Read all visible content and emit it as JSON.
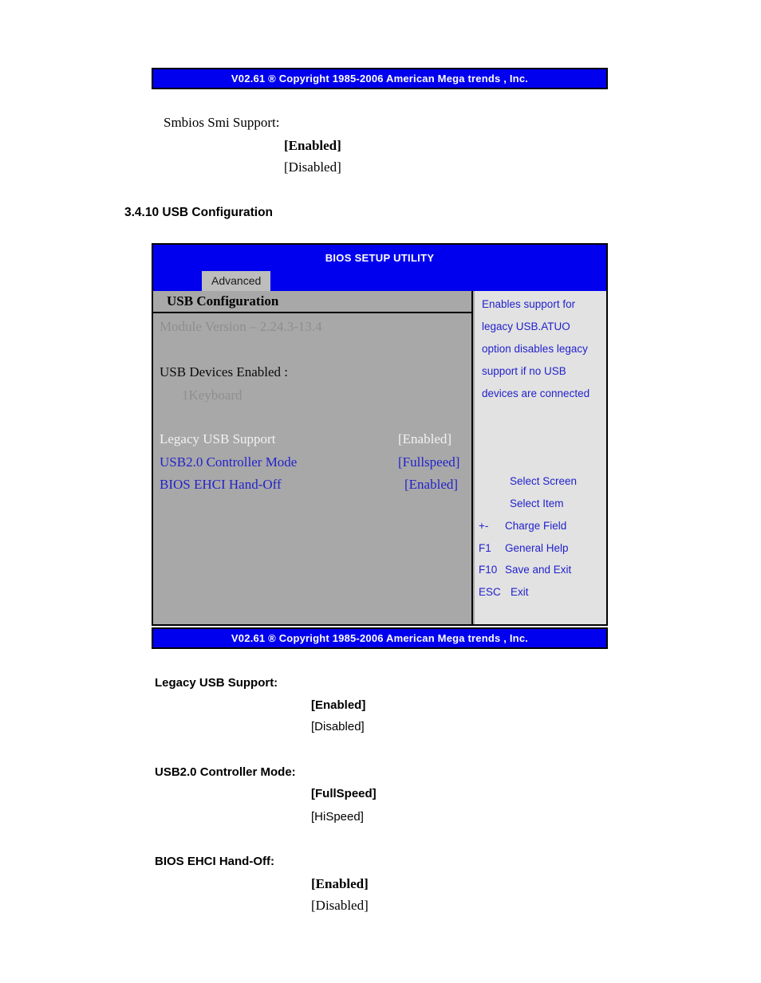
{
  "document": {
    "top_ami_bar": "V02.61 ® Copyright 1985-2006 American Mega trends , Inc.",
    "bottom_ami_bar": "V02.61 ® Copyright 1985-2006 American Mega trends , Inc.",
    "intro": {
      "label": "Smbios Smi Support:",
      "option_selected": "[Enabled]",
      "option_other": "[Disabled]"
    },
    "section_heading": "3.4.10 USB Configuration",
    "option_blocks": [
      {
        "heading": "Legacy USB Support:",
        "selected": "[Enabled]",
        "other": "[Disabled]"
      },
      {
        "heading": "USB2.0 Controller Mode:",
        "selected": "[FullSpeed]",
        "other": "[HiSpeed]"
      },
      {
        "heading": "BIOS EHCI Hand-Off:",
        "selected": "[Enabled]",
        "other": "[Disabled]"
      }
    ]
  },
  "bios": {
    "title": "BIOS SETUP UTILITY",
    "active_tab": "Advanced",
    "pane_title": "USB Configuration",
    "module_version": "Module Version – 2.24.3-13.4",
    "devices_label": "USB Devices Enabled :",
    "devices_value": "1Keyboard",
    "settings": [
      {
        "name": "Legacy USB Support",
        "value": "[Enabled]"
      },
      {
        "name": "USB2.0 Controller Mode",
        "value": "[Fullspeed]"
      },
      {
        "name": "BIOS EHCI Hand-Off",
        "value": "[Enabled]"
      }
    ],
    "help_lines": [
      "Enables support for",
      "legacy USB.ATUO",
      "option disables legacy",
      "support if no USB",
      "devices are connected"
    ],
    "legend": [
      {
        "key": "",
        "label": "Select Screen"
      },
      {
        "key": "",
        "label": "Select Item"
      },
      {
        "key": "+-",
        "label": "Charge Field"
      },
      {
        "key": "F1",
        "label": "General Help"
      },
      {
        "key": "F10",
        "label": "Save and Exit"
      },
      {
        "key": "ESC",
        "label": "Exit"
      }
    ]
  },
  "colors": {
    "bios_blue": "#0000ee",
    "left_pane_gray": "#a8a8a8",
    "right_pane_gray": "#e2e2e2",
    "tab_gray": "#bdbdbd",
    "text_blue": "#2222cc"
  }
}
